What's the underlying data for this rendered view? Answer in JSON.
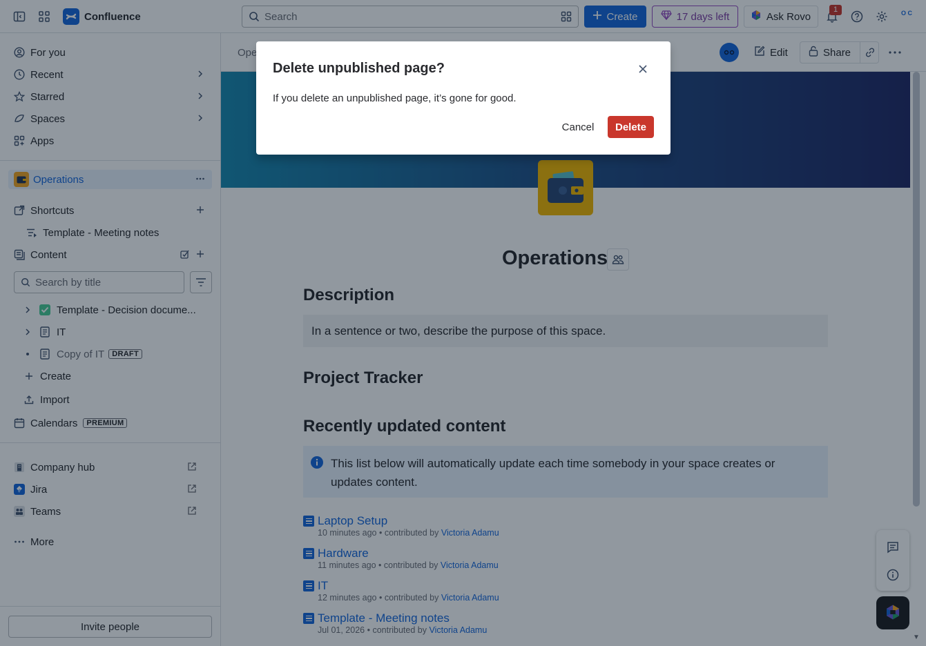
{
  "app": {
    "name": "Confluence"
  },
  "header": {
    "search_placeholder": "Search",
    "create_label": "Create",
    "trial_label": "17 days left",
    "rovo_label": "Ask Rovo",
    "notification_count": "1",
    "avatar_initials": "O C",
    "brand_color": "#1868db"
  },
  "sidebar": {
    "nav": [
      {
        "label": "For you",
        "icon": "person-circle-icon"
      },
      {
        "label": "Recent",
        "icon": "clock-icon"
      },
      {
        "label": "Starred",
        "icon": "star-icon"
      },
      {
        "label": "Spaces",
        "icon": "spaces-icon"
      },
      {
        "label": "Apps",
        "icon": "apps-icon"
      }
    ],
    "space_name": "Operations",
    "shortcuts_label": "Shortcuts",
    "shortcut_item": "Template - Meeting notes",
    "content_label": "Content",
    "search_placeholder": "Search by title",
    "tree": [
      {
        "label": "Template - Decision docume...",
        "icon": "check-emoji-icon"
      },
      {
        "label": "IT",
        "icon": "page-icon"
      },
      {
        "label": "Copy of IT",
        "icon": "page-icon",
        "badge": "DRAFT"
      }
    ],
    "create_label": "Create",
    "import_label": "Import",
    "calendars_label": "Calendars",
    "calendars_badge": "PREMIUM",
    "apps": [
      {
        "label": "Company hub"
      },
      {
        "label": "Jira"
      },
      {
        "label": "Teams"
      }
    ],
    "more_label": "More",
    "invite_label": "Invite people"
  },
  "page": {
    "breadcrumb": "Ope",
    "edit_label": "Edit",
    "share_label": "Share",
    "title": "Operations",
    "description_heading": "Description",
    "description_text": "In a sentence or two, describe the purpose of this space.",
    "tracker_heading": "Project Tracker",
    "recent_heading": "Recently updated content",
    "info_text": "This list below will automatically update each time somebody in your space creates or updates content.",
    "recent_items": [
      {
        "title": "Laptop Setup",
        "time": "10 minutes ago",
        "by": "contributed by",
        "author": "Victoria Adamu"
      },
      {
        "title": "Hardware",
        "time": "11 minutes ago",
        "by": "contributed by",
        "author": "Victoria Adamu"
      },
      {
        "title": "IT",
        "time": "12 minutes ago",
        "by": "contributed by",
        "author": "Victoria Adamu"
      },
      {
        "title": "Template - Meeting notes",
        "time": "Jul 01, 2026",
        "by": "contributed by",
        "author": "Victoria Adamu"
      }
    ]
  },
  "modal": {
    "title": "Delete unpublished page?",
    "body": "If you delete an unpublished page, it’s gone for good.",
    "cancel_label": "Cancel",
    "delete_label": "Delete",
    "danger_color": "#c9372c"
  }
}
